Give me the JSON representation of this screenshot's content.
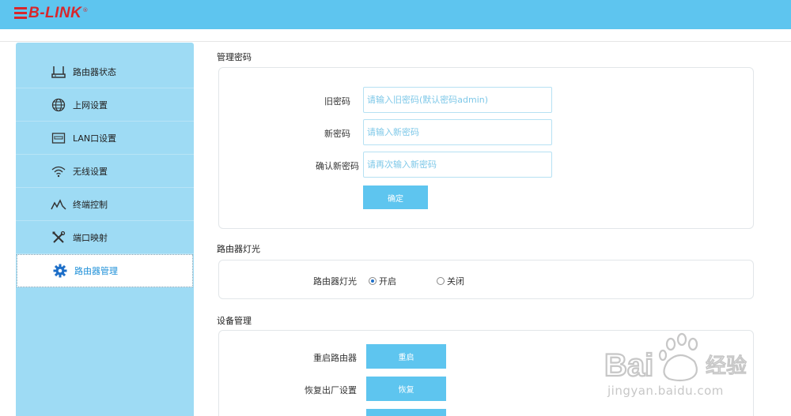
{
  "brand": {
    "logo_text": "B-LINK",
    "registered": "®"
  },
  "sidebar": {
    "items": [
      {
        "label": "路由器状态",
        "icon": "router-icon"
      },
      {
        "label": "上网设置",
        "icon": "globe-icon"
      },
      {
        "label": "LAN口设置",
        "icon": "lan-port-icon"
      },
      {
        "label": "无线设置",
        "icon": "wifi-icon"
      },
      {
        "label": "终端控制",
        "icon": "terminal-activity-icon"
      },
      {
        "label": "端口映射",
        "icon": "tools-icon"
      },
      {
        "label": "路由器管理",
        "icon": "gear-icon",
        "active": true
      }
    ]
  },
  "password": {
    "section_title": "管理密码",
    "old_label": "旧密码",
    "old_placeholder": "请输入旧密码(默认密码admin)",
    "new_label": "新密码",
    "new_placeholder": "请输入新密码",
    "confirm_label": "确认新密码",
    "confirm_placeholder": "请再次输入新密码",
    "submit_label": "确定"
  },
  "led": {
    "section_title": "路由器灯光",
    "label": "路由器灯光",
    "on_label": "开启",
    "off_label": "关闭",
    "selected": "on"
  },
  "device": {
    "section_title": "设备管理",
    "reboot_label": "重启路由器",
    "reboot_button": "重启",
    "reset_label": "恢复出厂设置",
    "reset_button": "恢复"
  },
  "watermark": {
    "text": "jingyan.baidu.com"
  },
  "colors": {
    "header": "#5ec5ef",
    "sidebar": "#9edbf4",
    "accent": "#1e90d8",
    "logo": "#d8262b"
  }
}
